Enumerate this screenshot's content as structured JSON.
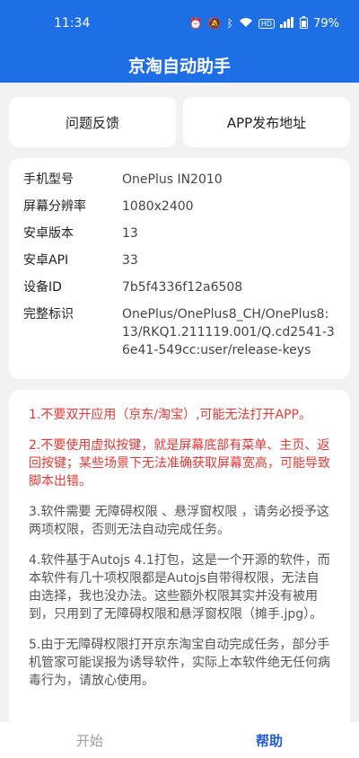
{
  "status": {
    "time": "11:34",
    "icons": [
      "alarm-icon",
      "mute-icon",
      "bluetooth-icon",
      "wifi-icon",
      "hd-icon",
      "signal-icon",
      "battery-icon"
    ],
    "battery": "79%"
  },
  "appbar": {
    "title": "京淘自动助手"
  },
  "buttons": {
    "feedback": "问题反馈",
    "app_url": "APP发布地址"
  },
  "device": {
    "rows": [
      {
        "label": "手机型号",
        "value": "OnePlus IN2010"
      },
      {
        "label": "屏幕分辨率",
        "value": "1080x2400"
      },
      {
        "label": "安卓版本",
        "value": "13"
      },
      {
        "label": "安卓API",
        "value": "33"
      },
      {
        "label": "设备ID",
        "value": "7b5f4336f12a6508"
      },
      {
        "label": "完整标识",
        "value": "OnePlus/OnePlus8_CH/OnePlus8:13/RKQ1.211119.001/Q.cd2541-36e41-549cc:user/release-keys"
      }
    ]
  },
  "help": {
    "tips": [
      "1.不要双开应用（京东/淘宝）,可能无法打开APP。",
      "2.不要使用虚拟按键，就是屏幕底部有菜单、主页、返回按键；某些场景下无法准确获取屏幕宽高，可能导致脚本出错。",
      "3.软件需要 无障碍权限 、悬浮窗权限 ，请务必授予这两项权限，否则无法自动完成任务。",
      "4.软件基于Autojs 4.1打包，这是一个开源的软件，而本软件有几十项权限都是Autojs自带得权限，无法自由选择，我也没办法。这些额外权限其实并没有被用到，只用到了无障碍权限和悬浮窗权限（摊手.jpg）。",
      "5.由于无障碍权限打开京东淘宝自动完成任务，部分手机管家可能误报为诱导软件，实际上本软件绝无任何病毒行为，请放心使用。"
    ],
    "tip_colors": [
      "#e53935",
      "#e53935",
      "#555555",
      "#555555",
      "#555555"
    ]
  },
  "nav": {
    "start": "开始",
    "help": "帮助"
  }
}
